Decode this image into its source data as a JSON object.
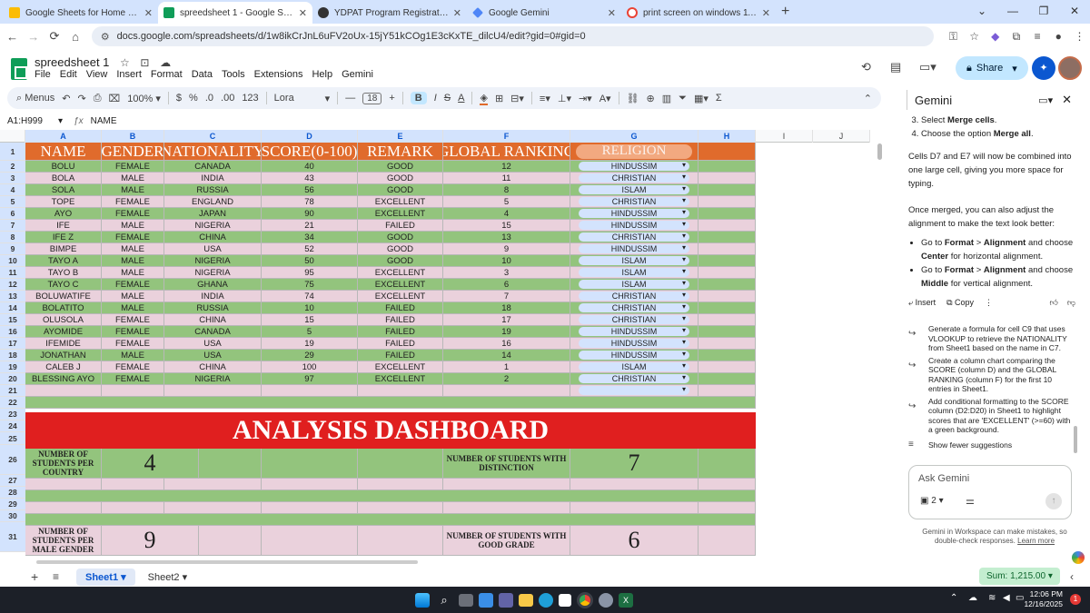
{
  "browser": {
    "tabs": [
      {
        "title": "Google Sheets for Home and Bu",
        "fav": "#fbbc04"
      },
      {
        "title": "spreedsheet 1 - Google Sheets",
        "fav": "#0f9d58"
      },
      {
        "title": "YDPAT Program Registration",
        "fav": "#333333"
      },
      {
        "title": "Google Gemini",
        "fav": "#4f86f7"
      },
      {
        "title": "print screen on windows 11 - Go",
        "fav": "#eeeeee"
      }
    ],
    "url": "docs.google.com/spreadsheets/d/1w8ikCrJnL6uFV2oUx-15jY51kCOg1E3cKxTE_dilcU4/edit?gid=0#gid=0"
  },
  "doc": {
    "title": "spreedsheet 1",
    "menus": [
      "File",
      "Edit",
      "View",
      "Insert",
      "Format",
      "Data",
      "Tools",
      "Extensions",
      "Help",
      "Gemini"
    ],
    "share_label": "Share"
  },
  "toolbar": {
    "search": "Menus",
    "zoom": "100%",
    "currency": "$",
    "percent": "%",
    "dec_minus": ".0",
    "dec_plus": ".00",
    "numfmt": "123",
    "font": "Lora",
    "size": "18"
  },
  "formula": {
    "namebox": "A1:H999",
    "value": "NAME"
  },
  "columns": [
    "A",
    "B",
    "C",
    "D",
    "E",
    "F",
    "G",
    "H",
    "I",
    "J"
  ],
  "rows": [
    "1",
    "2",
    "3",
    "4",
    "5",
    "6",
    "7",
    "8",
    "9",
    "10",
    "11",
    "12",
    "13",
    "14",
    "15",
    "16",
    "17",
    "18",
    "19",
    "20",
    "21",
    "22",
    "23",
    "24",
    "25",
    "26",
    "27",
    "28",
    "29",
    "30",
    "31"
  ],
  "headers": [
    "NAME",
    "GENDER",
    "NATIONALITY",
    "SCORE(0-100)",
    "REMARK",
    "GLOBAL RANKING",
    "RELIGION"
  ],
  "students": [
    [
      "BOLU",
      "FEMALE",
      "CANADA",
      "40",
      "GOOD",
      "12",
      "HINDUSSIM"
    ],
    [
      "BOLA",
      "MALE",
      "INDIA",
      "43",
      "GOOD",
      "11",
      "CHRISTIAN"
    ],
    [
      "SOLA",
      "MALE",
      "RUSSIA",
      "56",
      "GOOD",
      "8",
      "ISLAM"
    ],
    [
      "TOPE",
      "FEMALE",
      "ENGLAND",
      "78",
      "EXCELLENT",
      "5",
      "CHRISTIAN"
    ],
    [
      "AYO",
      "FEMALE",
      "JAPAN",
      "90",
      "EXCELLENT",
      "4",
      "HINDUSSIM"
    ],
    [
      "IFE",
      "MALE",
      "NIGERIA",
      "21",
      "FAILED",
      "15",
      "HINDUSSIM"
    ],
    [
      "IFE Z",
      "FEMALE",
      "CHINA",
      "34",
      "GOOD",
      "13",
      "CHRISTIAN"
    ],
    [
      "BIMPE",
      "MALE",
      "USA",
      "52",
      "GOOD",
      "9",
      "HINDUSSIM"
    ],
    [
      "TAYO A",
      "MALE",
      "NIGERIA",
      "50",
      "GOOD",
      "10",
      "ISLAM"
    ],
    [
      "TAYO B",
      "MALE",
      "NIGERIA",
      "95",
      "EXCELLENT",
      "3",
      "ISLAM"
    ],
    [
      "TAYO C",
      "FEMALE",
      "GHANA",
      "75",
      "EXCELLENT",
      "6",
      "ISLAM"
    ],
    [
      "BOLUWATIFE",
      "MALE",
      "INDIA",
      "74",
      "EXCELLENT",
      "7",
      "CHRISTIAN"
    ],
    [
      "BOLATITO",
      "MALE",
      "RUSSIA",
      "10",
      "FAILED",
      "18",
      "CHRISTIAN"
    ],
    [
      "OLUSOLA",
      "FEMALE",
      "CHINA",
      "15",
      "FAILED",
      "17",
      "CHRISTIAN"
    ],
    [
      "AYOMIDE",
      "FEMALE",
      "CANADA",
      "5",
      "FAILED",
      "19",
      "HINDUSSIM"
    ],
    [
      "IFEMIDE",
      "FEMALE",
      "USA",
      "19",
      "FAILED",
      "16",
      "HINDUSSIM"
    ],
    [
      "JONATHAN",
      "MALE",
      "USA",
      "29",
      "FAILED",
      "14",
      "HINDUSSIM"
    ],
    [
      "CALEB J",
      "FEMALE",
      "CHINA",
      "100",
      "EXCELLENT",
      "1",
      "ISLAM"
    ],
    [
      "BLESSING AYO",
      "FEMALE",
      "NIGERIA",
      "97",
      "EXCELLENT",
      "2",
      "CHRISTIAN"
    ]
  ],
  "dashboard": {
    "title": "ANALYSIS DASHBOARD",
    "r26_label": "NUMBER OF STUDENTS PER COUNTRY",
    "r26_value": "4",
    "r26_label2": "NUMBER OF STUDENTS WITH DISTINCTION",
    "r26_value2": "7",
    "r31_label": "NUMBER OF STUDENTS PER MALE GENDER",
    "r31_value": "9",
    "r31_label2": "NUMBER OF STUDENTS WITH GOOD GRADE",
    "r31_value2": "6"
  },
  "gemini": {
    "title": "Gemini",
    "step3_pre": "Select ",
    "step3_bold": "Merge cells",
    "step4_pre": "Choose the option ",
    "step4_bold": "Merge all",
    "para1": "Cells D7 and E7 will now be combined into one large cell, giving you more space for typing.",
    "para2": "Once merged, you can also adjust the alignment to make the text look better:",
    "b1_pre": "Go to ",
    "b1_format": "Format",
    "b1_gt": " > ",
    "b1_align": "Alignment",
    "b1_mid": " and choose ",
    "b1_center": "Center",
    "b1_end": " for horizontal alignment.",
    "b2_middle": "Middle",
    "b2_end": " for vertical alignment.",
    "insert": "Insert",
    "copy": "Copy",
    "suggestions": [
      "Generate a formula for cell C9 that uses VLOOKUP to retrieve the NATIONALITY from Sheet1 based on the name in C7.",
      "Create a column chart comparing the SCORE (column D) and the GLOBAL RANKING (column F) for the first 10 entries in Sheet1.",
      "Add conditional formatting to the SCORE column (D2:D20) in Sheet1 to highlight scores that are 'EXCELLENT' (>=60) with a green background."
    ],
    "fewer": "Show fewer suggestions",
    "ask_placeholder": "Ask Gemini",
    "attach_count": "2",
    "disclaimer": "Gemini in Workspace can make mistakes, so double-check responses.",
    "learn_more": "Learn more"
  },
  "sheets": [
    "Sheet1",
    "Sheet2"
  ],
  "sum": "Sum: 1,215.00",
  "clock": {
    "time": "12:06 PM",
    "date": "12/16/2025"
  },
  "notif": "1"
}
